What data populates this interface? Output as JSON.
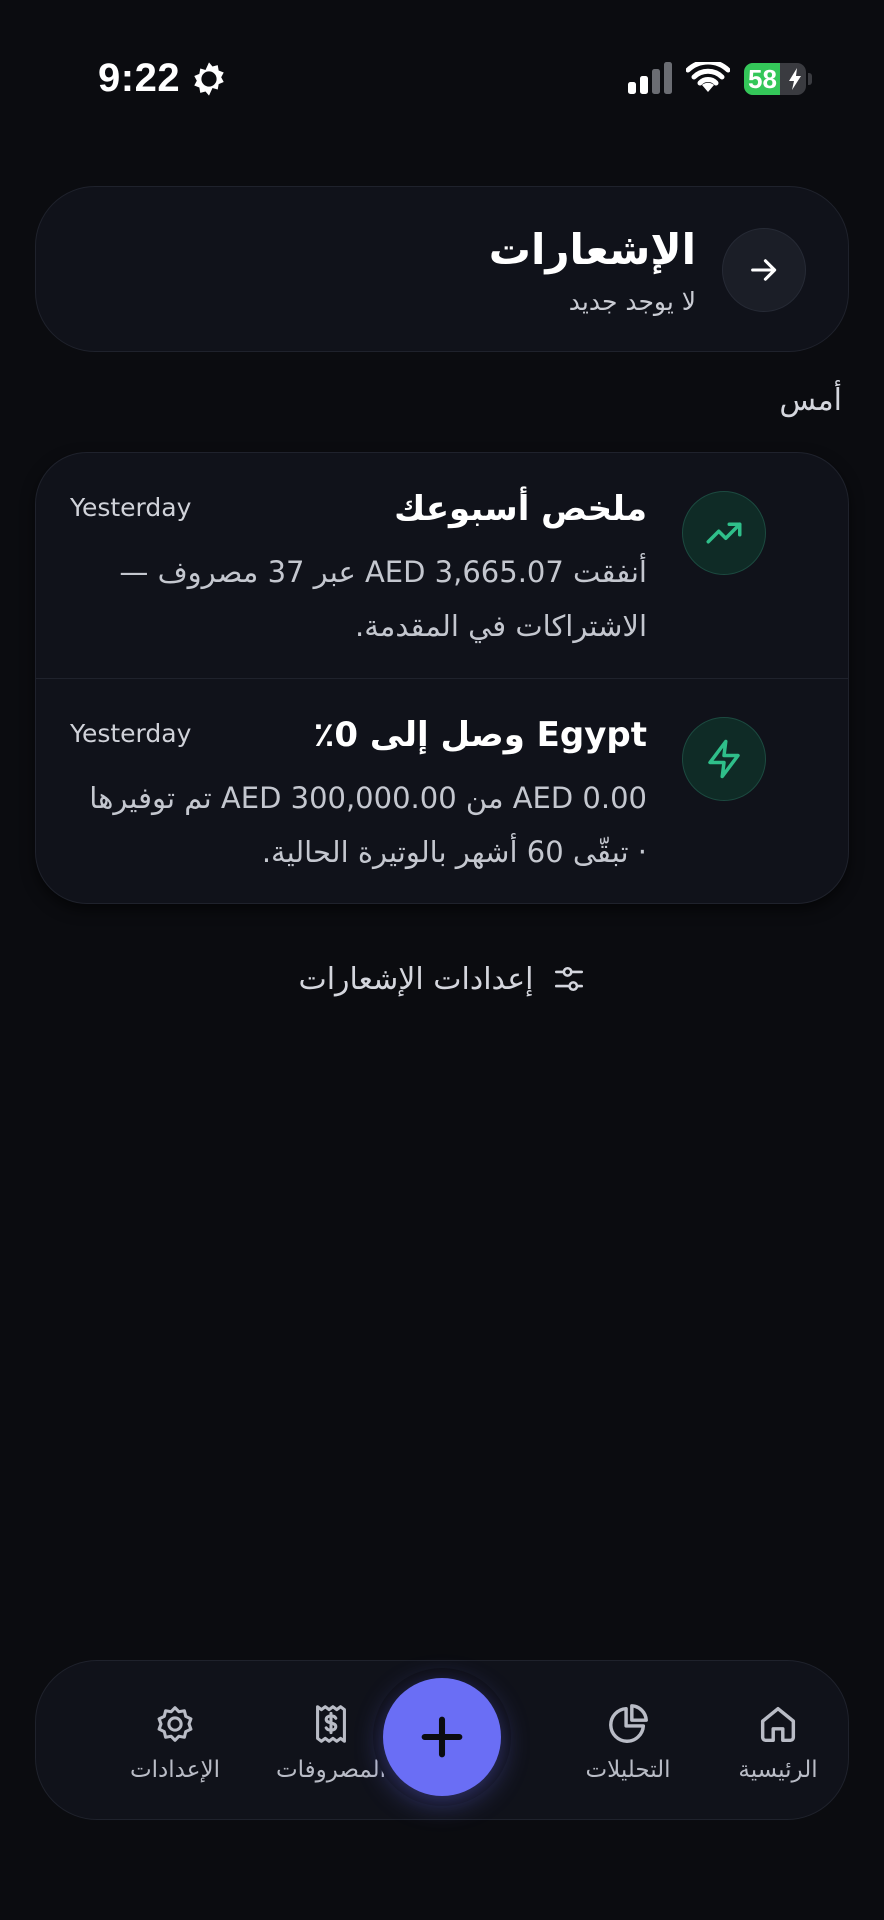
{
  "status_bar": {
    "time": "9:22",
    "battery_level": "58",
    "battery_fraction": 0.58,
    "colors": {
      "battery": "#34c759"
    }
  },
  "header": {
    "title": "الإشعارات",
    "subtitle": "لا يوجد جديد",
    "back_icon": "arrow-right-icon"
  },
  "section": {
    "label": "أمس"
  },
  "notifications": [
    {
      "icon": "trending-up-icon",
      "title": "ملخص أسبوعك",
      "time": "Yesterday",
      "body": "أنفقت AED 3,665.07 عبر 37 مصروف — الاشتراكات في المقدمة."
    },
    {
      "icon": "lightning-icon",
      "title": "Egypt وصل إلى 0٪",
      "time": "Yesterday",
      "body": "AED 0.00 من AED 300,000.00 تم توفيرها · تبقّى 60 أشهر بالوتيرة الحالية."
    }
  ],
  "settings_link": {
    "label": "إعدادات الإشعارات",
    "icon": "sliders-icon"
  },
  "bottom_nav": {
    "items": [
      {
        "label": "الرئيسية",
        "icon": "home-icon"
      },
      {
        "label": "التحليلات",
        "icon": "pie-chart-icon"
      },
      {
        "label": "المصروفات",
        "icon": "receipt-icon"
      },
      {
        "label": "الإعدادات",
        "icon": "gear-icon"
      }
    ],
    "fab_icon": "plus-icon"
  },
  "colors": {
    "background": "#0b0c10",
    "card": "#10121a",
    "accent": "#6a6ef5",
    "success": "#2fbf8a"
  }
}
